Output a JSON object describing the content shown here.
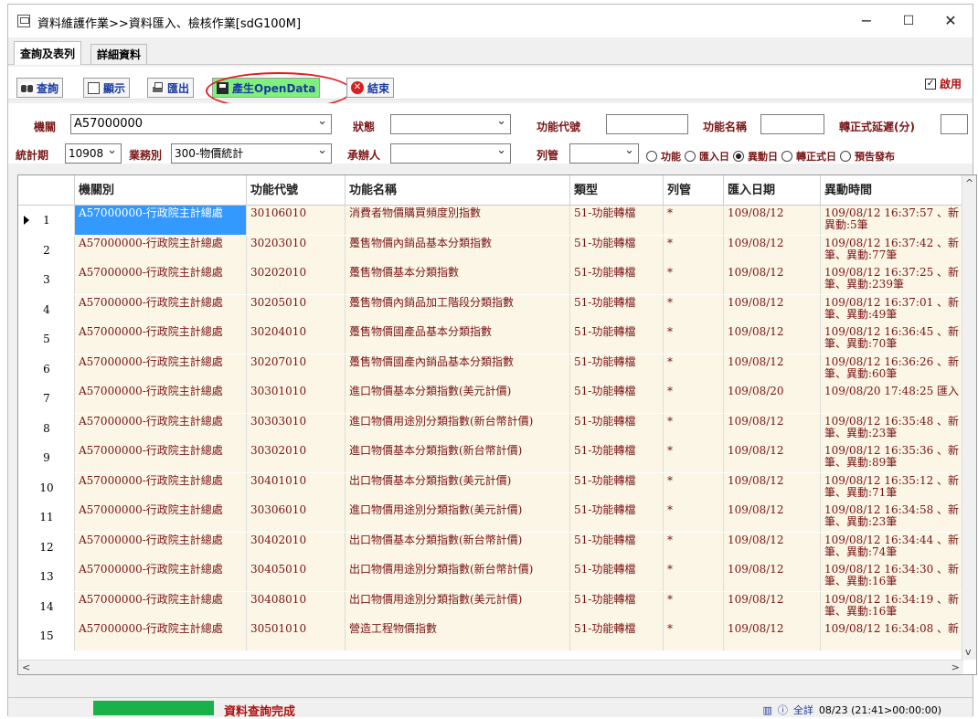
{
  "window": {
    "title": "資料維護作業>>資料匯入、檢核作業[sdG100M]",
    "minimize": "−",
    "maximize": "☐",
    "close": "✕"
  },
  "tabs": [
    {
      "label": "查詢及表列",
      "active": true
    },
    {
      "label": "詳細資料",
      "active": false
    }
  ],
  "toolbar": {
    "query": "查詢",
    "display": "顯示",
    "import": "匯出",
    "generate": "產生OpenData",
    "end": "結束",
    "enable_label": "啟用",
    "enable_checked": true
  },
  "filters": {
    "agency_label": "機關",
    "agency_value": "A57000000",
    "status_label": "狀態",
    "status_value": "",
    "func_code_label": "功能代號",
    "func_code_value": "",
    "func_name_label": "功能名稱",
    "func_name_value": "",
    "delay_label": "轉正式延遲(分)",
    "delay_value": "",
    "period_label": "統計期",
    "period_value": "10908",
    "business_label": "業務別",
    "business_value": "300-物價統計",
    "handler_label": "承辦人",
    "handler_value": "",
    "listed_label": "列管",
    "listed_value": "",
    "radios": [
      {
        "label": "功能",
        "checked": false
      },
      {
        "label": "匯入日",
        "checked": false
      },
      {
        "label": "異動日",
        "checked": true
      },
      {
        "label": "轉正式日",
        "checked": false
      },
      {
        "label": "預告發布",
        "checked": false
      }
    ]
  },
  "grid": {
    "columns": [
      "機關別",
      "功能代號",
      "功能名稱",
      "類型",
      "列管",
      "匯入日期",
      "異動時間"
    ],
    "rows": [
      {
        "n": "1",
        "agency": "A57000000-行政院主計總處",
        "code": "30106010",
        "name": "消費者物價購買頻度別指數",
        "type": "51-功能轉檔",
        "listed": "*",
        "date": "109/08/12",
        "mod": "109/08/12 16:37:57 、新異動:5筆"
      },
      {
        "n": "2",
        "agency": "A57000000-行政院主計總處",
        "code": "30203010",
        "name": "躉售物價內銷品基本分類指數",
        "type": "51-功能轉檔",
        "listed": "*",
        "date": "109/08/12",
        "mod": "109/08/12 16:37:42 、新筆、異動:77筆"
      },
      {
        "n": "3",
        "agency": "A57000000-行政院主計總處",
        "code": "30202010",
        "name": "躉售物價基本分類指數",
        "type": "51-功能轉檔",
        "listed": "*",
        "date": "109/08/12",
        "mod": "109/08/12 16:37:25 、新筆、異動:239筆"
      },
      {
        "n": "4",
        "agency": "A57000000-行政院主計總處",
        "code": "30205010",
        "name": "躉售物價內銷品加工階段分類指數",
        "type": "51-功能轉檔",
        "listed": "*",
        "date": "109/08/12",
        "mod": "109/08/12 16:37:01 、新筆、異動:49筆"
      },
      {
        "n": "5",
        "agency": "A57000000-行政院主計總處",
        "code": "30204010",
        "name": "躉售物價國產品基本分類指數",
        "type": "51-功能轉檔",
        "listed": "*",
        "date": "109/08/12",
        "mod": "109/08/12 16:36:45 、新筆、異動:70筆"
      },
      {
        "n": "6",
        "agency": "A57000000-行政院主計總處",
        "code": "30207010",
        "name": "躉售物價國產內銷品基本分類指數",
        "type": "51-功能轉檔",
        "listed": "*",
        "date": "109/08/12",
        "mod": "109/08/12 16:36:26 、新筆、異動:60筆"
      },
      {
        "n": "7",
        "agency": "A57000000-行政院主計總處",
        "code": "30301010",
        "name": "進口物價基本分類指數(美元計價)",
        "type": "51-功能轉檔",
        "listed": "*",
        "date": "109/08/20",
        "mod": "109/08/20 17:48:25 匯入"
      },
      {
        "n": "8",
        "agency": "A57000000-行政院主計總處",
        "code": "30303010",
        "name": "進口物價用途別分類指數(新台幣計價)",
        "type": "51-功能轉檔",
        "listed": "*",
        "date": "109/08/12",
        "mod": "109/08/12 16:35:48 、新筆、異動:23筆"
      },
      {
        "n": "9",
        "agency": "A57000000-行政院主計總處",
        "code": "30302010",
        "name": "進口物價基本分類指數(新台幣計價)",
        "type": "51-功能轉檔",
        "listed": "*",
        "date": "109/08/12",
        "mod": "109/08/12 16:35:36 、新筆、異動:89筆"
      },
      {
        "n": "10",
        "agency": "A57000000-行政院主計總處",
        "code": "30401010",
        "name": "出口物價基本分類指數(美元計價)",
        "type": "51-功能轉檔",
        "listed": "*",
        "date": "109/08/12",
        "mod": "109/08/12 16:35:12 、新筆、異動:71筆"
      },
      {
        "n": "11",
        "agency": "A57000000-行政院主計總處",
        "code": "30306010",
        "name": "進口物價用途別分類指數(美元計價)",
        "type": "51-功能轉檔",
        "listed": "*",
        "date": "109/08/12",
        "mod": "109/08/12 16:34:58 、新筆、異動:23筆"
      },
      {
        "n": "12",
        "agency": "A57000000-行政院主計總處",
        "code": "30402010",
        "name": "出口物價基本分類指數(新台幣計價)",
        "type": "51-功能轉檔",
        "listed": "*",
        "date": "109/08/12",
        "mod": "109/08/12 16:34:44 、新筆、異動:74筆"
      },
      {
        "n": "13",
        "agency": "A57000000-行政院主計總處",
        "code": "30405010",
        "name": "出口物價用途別分類指數(新台幣計價)",
        "type": "51-功能轉檔",
        "listed": "*",
        "date": "109/08/12",
        "mod": "109/08/12 16:34:30 、新筆、異動:16筆"
      },
      {
        "n": "14",
        "agency": "A57000000-行政院主計總處",
        "code": "30408010",
        "name": "出口物價用途別分類指數(美元計價)",
        "type": "51-功能轉檔",
        "listed": "*",
        "date": "109/08/12",
        "mod": "109/08/12 16:34:19 、新筆、異動:16筆"
      },
      {
        "n": "15",
        "agency": "A57000000-行政院主計總處",
        "code": "30501010",
        "name": "營造工程物價指數",
        "type": "51-功能轉檔",
        "listed": "*",
        "date": "109/08/12",
        "mod": "109/08/12 16:34:08 、新"
      }
    ]
  },
  "status": {
    "message": "資料查詢完成",
    "detail_label": "全詳",
    "datetime": "08/23 (21:41>00:00:00)",
    "progress_pct": 100
  }
}
